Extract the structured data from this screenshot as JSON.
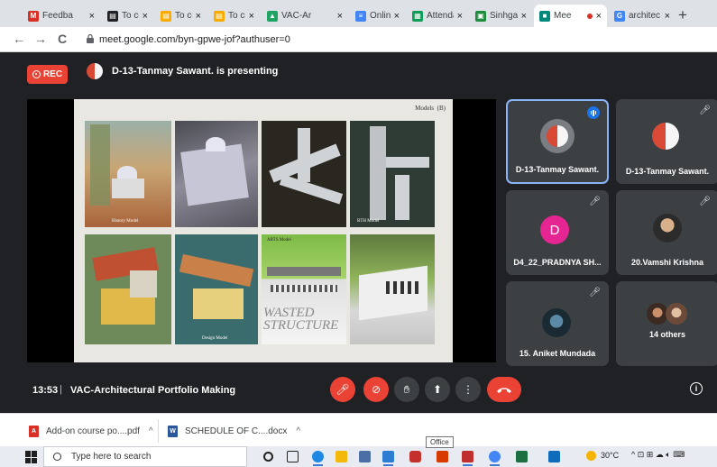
{
  "browser": {
    "tabs": [
      {
        "label": "Feedba",
        "icon": "gmail-icon",
        "color": "#d93025",
        "glyph": "M"
      },
      {
        "label": "To com",
        "icon": "document-icon",
        "color": "#202124",
        "glyph": "▤"
      },
      {
        "label": "To com",
        "icon": "keep-icon",
        "color": "#f9ab00",
        "glyph": "▤"
      },
      {
        "label": "To com",
        "icon": "keep-icon",
        "color": "#f9ab00",
        "glyph": "▤"
      },
      {
        "label": "VAC-Ar",
        "icon": "drive-icon",
        "color": "#1fa463",
        "glyph": "▲"
      },
      {
        "label": "Online",
        "icon": "forms-icon",
        "color": "#4285f4",
        "glyph": "≡"
      },
      {
        "label": "Attenda",
        "icon": "sheets-icon",
        "color": "#0f9d58",
        "glyph": "▦"
      },
      {
        "label": "Sinhgad",
        "icon": "classroom-icon",
        "color": "#1e8e3e",
        "glyph": "▣"
      },
      {
        "label": "Mee",
        "icon": "meet-icon",
        "color": "#00897b",
        "glyph": "■",
        "active": true
      },
      {
        "label": "architec",
        "icon": "google-icon",
        "color": "#4285f4",
        "glyph": "G"
      }
    ],
    "new_tab": "+",
    "nav": {
      "back": "←",
      "forward": "→",
      "reload": "C"
    },
    "url": "meet.google.com/byn-gpwe-jof?authuser=0"
  },
  "meet": {
    "rec_label": "REC",
    "presenting_text": "D-13-Tanmay Sawant. is presenting",
    "slide": {
      "title": "Models",
      "page": "(B)",
      "captions": [
        "History Model",
        "BTH Model",
        "Design Model",
        "ARTS Model"
      ],
      "overlay_text": [
        "WASTED",
        "STRUCTURE"
      ]
    },
    "participants": [
      {
        "name": "D-13-Tanmay Sawant.",
        "speaking": true,
        "muted": false
      },
      {
        "name": "D-13-Tanmay Sawant.",
        "speaking": false,
        "muted": true
      },
      {
        "name": "D4_22_PRADNYA SH...",
        "initial": "D",
        "avatar_color": "#e52592",
        "muted": true
      },
      {
        "name": "20.Vamshi Krishna",
        "muted": true
      },
      {
        "name": "15. Aniket Mundada",
        "muted": true
      },
      {
        "name": "14 others"
      }
    ],
    "time": "13:53",
    "separator": "|",
    "meeting_title": "VAC-Architectural Portfolio Making",
    "controls": {
      "mic_icon": "🎤︎",
      "cam_icon": "⊘",
      "hand_icon": "✋︎",
      "present_icon": "⬆",
      "more_icon": "⋮",
      "info_icon": "i"
    }
  },
  "downloads": {
    "items": [
      {
        "name": "Add-on course po....pdf",
        "icon": "pdf-icon",
        "color": "#d93025",
        "glyph": "A"
      },
      {
        "name": "SCHEDULE OF C....docx",
        "icon": "word-icon",
        "color": "#2b579a",
        "glyph": "W"
      }
    ],
    "caret": "^",
    "tooltip": "Office"
  },
  "taskbar": {
    "search_placeholder": "Type here to search",
    "temperature": "30°C",
    "tray_icons": "^ ⊡ ⊞ ☁ 🔈︎ ⌨"
  }
}
